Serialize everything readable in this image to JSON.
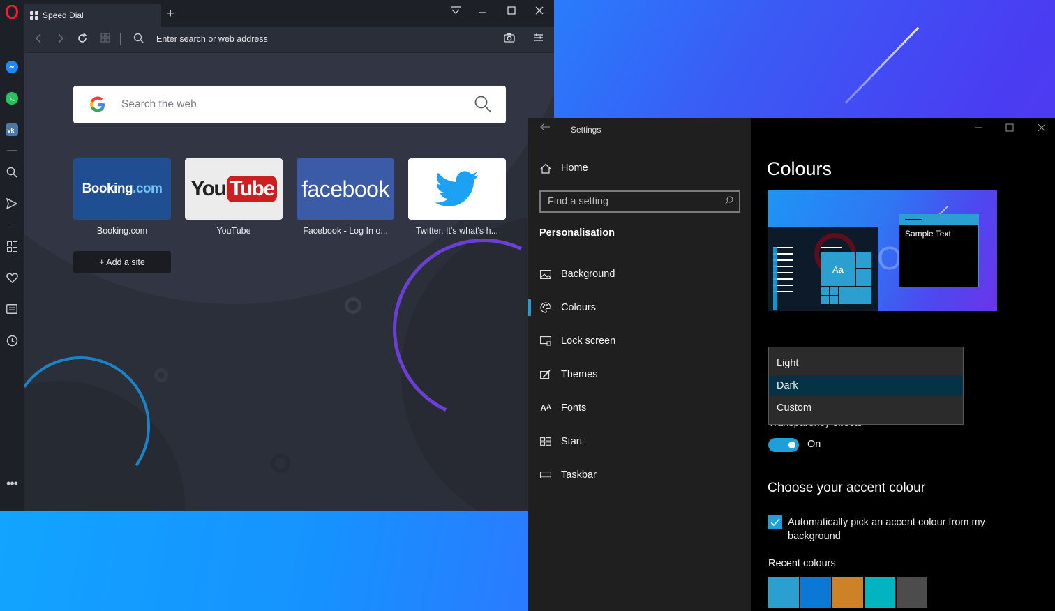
{
  "opera": {
    "tab_title": "Speed Dial",
    "new_tab_symbol": "+",
    "address_placeholder": "Enter search or web address",
    "search_placeholder": "Search the web",
    "tiles": [
      {
        "label": "Booking.com",
        "logo_text": "Booking",
        "logo_suffix": ".com",
        "bg": "#1f4e93"
      },
      {
        "label": "YouTube",
        "logo_text": "You",
        "logo_suffix": "Tube",
        "bg": "#ececec"
      },
      {
        "label": "Facebook - Log In o...",
        "logo_text": "facebook",
        "logo_suffix": "",
        "bg": "#3b5ba6"
      },
      {
        "label": "Twitter. It's what's h...",
        "logo_text": "",
        "logo_suffix": "",
        "bg": "#ffffff"
      }
    ],
    "add_site_label": "+ Add a site",
    "sidebar_icons": [
      "opera-logo-icon",
      "messenger-icon",
      "whatsapp-icon",
      "vk-icon",
      "search-icon",
      "send-icon",
      "speed-dial-icon",
      "heart-icon",
      "news-icon",
      "history-icon",
      "more-icon"
    ]
  },
  "settings": {
    "window_title": "Settings",
    "home_label": "Home",
    "find_placeholder": "Find a setting",
    "section_heading": "Personalisation",
    "nav_items": [
      {
        "label": "Background",
        "icon": "image-icon"
      },
      {
        "label": "Colours",
        "icon": "palette-icon"
      },
      {
        "label": "Lock screen",
        "icon": "lock-screen-icon"
      },
      {
        "label": "Themes",
        "icon": "themes-icon"
      },
      {
        "label": "Fonts",
        "icon": "fonts-icon"
      },
      {
        "label": "Start",
        "icon": "start-icon"
      },
      {
        "label": "Taskbar",
        "icon": "taskbar-icon"
      }
    ],
    "page_heading": "Colours",
    "preview_sample_text": "Sample Text",
    "preview_tile_text": "Aa",
    "mode_options": [
      "Light",
      "Dark",
      "Custom"
    ],
    "mode_selected": "Dark",
    "transparency_label": "Transparency effects",
    "toggle_state": "On",
    "accent_heading": "Choose your accent colour",
    "auto_accent_label": "Automatically pick an accent colour from my background",
    "recent_colours_heading": "Recent colours",
    "recent_colours": [
      "#2a9fd0",
      "#0b78d6",
      "#cd8227",
      "#02b4bf",
      "#4c4c4c"
    ],
    "accent_color": "#1e9fd9"
  }
}
